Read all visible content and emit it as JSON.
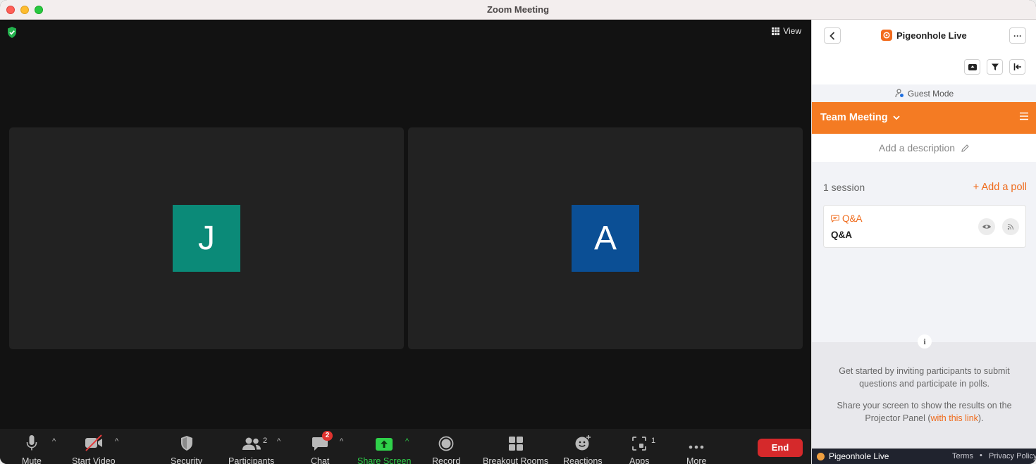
{
  "window": {
    "title": "Zoom Meeting"
  },
  "stage": {
    "view_label": "View",
    "participants": [
      {
        "initial": "J",
        "color": "#0b8a78"
      },
      {
        "initial": "A",
        "color": "#0b4f95"
      }
    ]
  },
  "toolbar": {
    "mute": "Mute",
    "start_video": "Start Video",
    "security": "Security",
    "participants": "Participants",
    "participants_count": "2",
    "chat": "Chat",
    "chat_badge": "2",
    "share_screen": "Share Screen",
    "record": "Record",
    "breakout_rooms": "Breakout Rooms",
    "reactions": "Reactions",
    "apps": "Apps",
    "apps_count": "1",
    "more": "More",
    "end": "End",
    "accent_green": "#2fd14a",
    "end_color": "#d5292b"
  },
  "panel": {
    "app_title": "Pigeonhole Live",
    "guest_mode": "Guest Mode",
    "event_title": "Team Meeting",
    "add_description": "Add a description",
    "sessions_count": "1 session",
    "add_poll": "+ Add a poll",
    "session": {
      "type": "Q&A",
      "name": "Q&A"
    },
    "info_text_1": "Get started by inviting participants to submit questions and participate in polls.",
    "info_text_2_prefix": "Share your screen to show the results on the Projector Panel (",
    "info_link": "with this link",
    "info_text_2_suffix": ").",
    "footer_brand": "Pigeonhole Live",
    "footer_terms": "Terms",
    "footer_dot": "•",
    "footer_privacy": "Privacy Policy",
    "accent_orange": "#f47b23"
  }
}
